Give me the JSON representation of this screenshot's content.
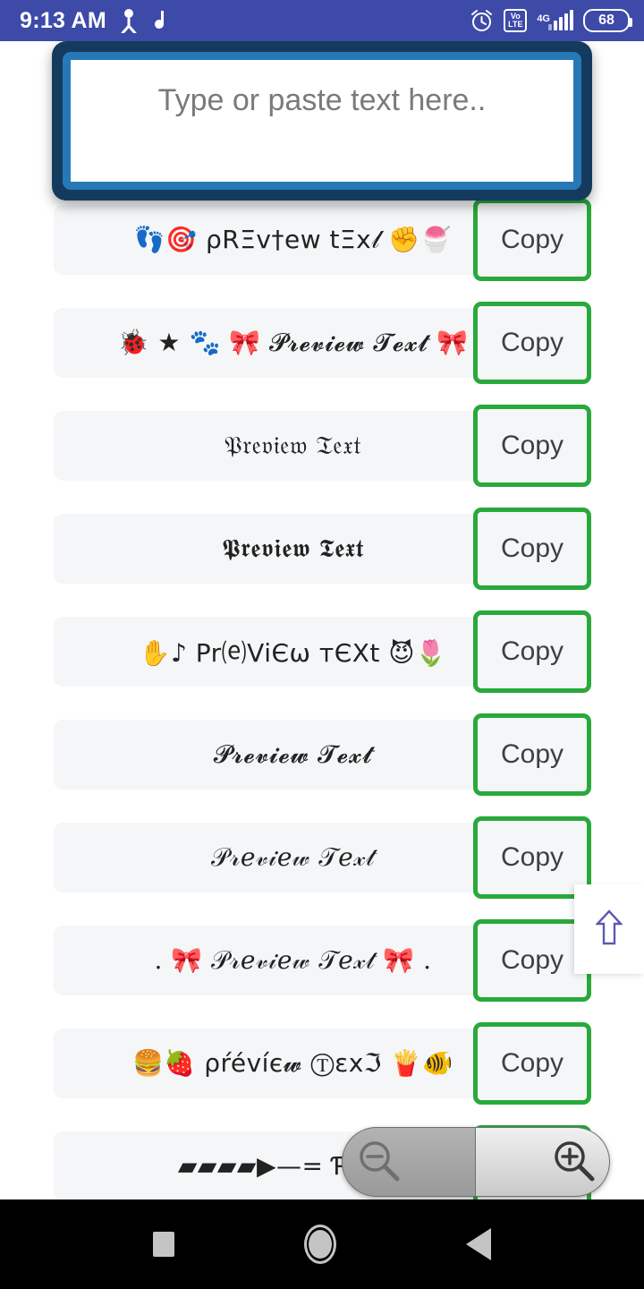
{
  "status_bar": {
    "time": "9:13 AM",
    "background_color": "#3d4aa8",
    "icons": [
      "person-icon",
      "music-note-icon",
      "alarm-icon",
      "volte-icon",
      "signal-icon",
      "battery-icon"
    ],
    "network_label": "4G",
    "volte_top": "Vo",
    "volte_bottom": "LTE",
    "battery_level": "68"
  },
  "input": {
    "placeholder": "Type or paste text here..",
    "value": "",
    "outer_border_color": "#143b5e",
    "inner_border_color": "#2679b6"
  },
  "list": {
    "copy_label": "Copy",
    "copy_border_color": "#29a93c",
    "row_background": "#f4f6f8",
    "rows": [
      {
        "id": "row-1",
        "preview": "👣🎯 ρRΞv†ew tΞx𝓁 ✊🍧",
        "style": "sans"
      },
      {
        "id": "row-2",
        "preview": "🐞 ★ 🐾 🎀 𝓟𝓻𝓮𝓿𝓲𝓮𝔀 𝓣𝓮𝔁𝓽 🎀",
        "style": "serif"
      },
      {
        "id": "row-3",
        "preview": "𝔓𝔯𝔢𝔳𝔦𝔢𝔴 𝔗𝔢𝔵𝔱",
        "style": "serif"
      },
      {
        "id": "row-4",
        "preview": "𝕻𝖗𝖊𝖛𝖎𝖊𝖜 𝕿𝖊𝖝𝖙",
        "style": "serif"
      },
      {
        "id": "row-5",
        "preview": "✋♪ Pr⒠ViЄω тЄXt 😈🌷",
        "style": "sans"
      },
      {
        "id": "row-6",
        "preview": "𝓟𝓻𝓮𝓿𝓲𝓮𝔀 𝓣𝓮𝔁𝓽",
        "style": "serif"
      },
      {
        "id": "row-7",
        "preview": "𝒫𝓇𝑒𝓋𝒾𝑒𝓌 𝒯𝑒𝓍𝓉",
        "style": "serif"
      },
      {
        "id": "row-8",
        "preview": ". 🎀 𝒫𝓇𝑒𝓋𝒾𝑒𝓌 𝒯𝑒𝓍𝓉 🎀 .",
        "style": "serif"
      },
      {
        "id": "row-9",
        "preview": "🍔🍓 ρŕévíє𝔀 Ⓣεxℑ 🍟🐠",
        "style": "sans"
      },
      {
        "id": "row-10",
        "preview": "▰▰▰▰▶—= ƤŖĘVĮ",
        "style": "sans"
      }
    ]
  },
  "scroll_to_top": {
    "icon": "arrow-up-icon",
    "color": "#5b59b0"
  },
  "zoom_widget": {
    "zoom_out_label": "zoom-out-icon",
    "zoom_in_label": "zoom-in-icon"
  },
  "nav_bar": {
    "recents": "recents-button",
    "home": "home-button",
    "back": "back-button"
  }
}
